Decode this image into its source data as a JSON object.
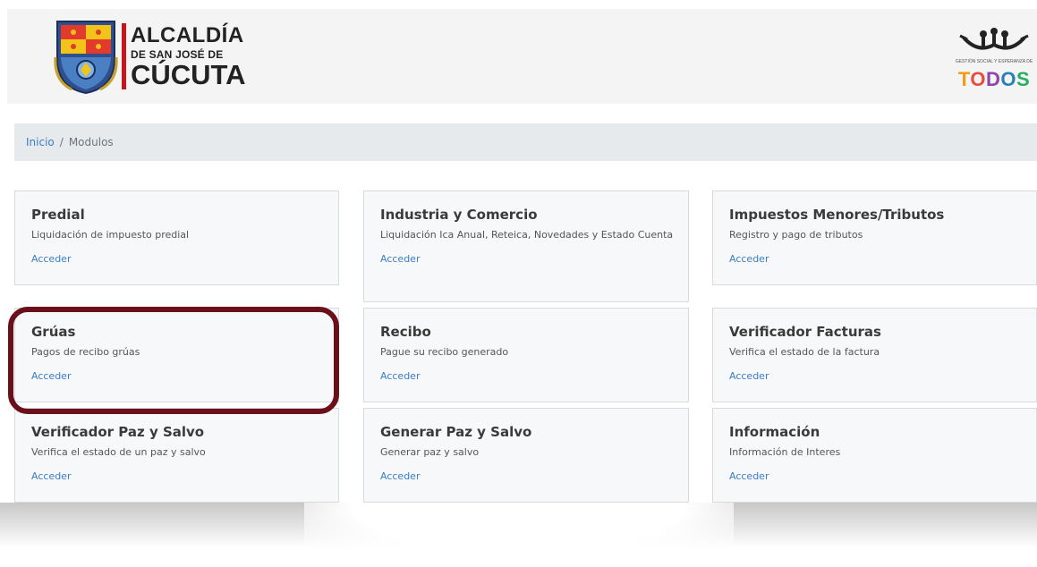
{
  "header": {
    "logo_left": {
      "line1": "ALCALDÍA",
      "line2": "DE SAN JOSÉ DE",
      "line3": "CÚCUTA"
    },
    "logo_right": {
      "tagline": "GESTIÓN SOCIAL Y ESPERANZA DE",
      "brand": "TODOS",
      "letters": [
        "T",
        "O",
        "D",
        "O",
        "S"
      ]
    }
  },
  "breadcrumb": {
    "home": "Inicio",
    "separator": "/",
    "current": "Modulos"
  },
  "cards": [
    {
      "title": "Predial",
      "desc": "Liquidación de impuesto predial",
      "link": "Acceder"
    },
    {
      "title": "Industria y Comercio",
      "desc": "Liquidación Ica Anual, Reteica, Novedades y Estado Cuenta",
      "link": "Acceder"
    },
    {
      "title": "Impuestos Menores/Tributos",
      "desc": "Registro y pago de tributos",
      "link": "Acceder"
    },
    {
      "title": "Grúas",
      "desc": "Pagos de recibo grúas",
      "link": "Acceder"
    },
    {
      "title": "Recibo",
      "desc": "Pague su recibo generado",
      "link": "Acceder"
    },
    {
      "title": "Verificador Facturas",
      "desc": "Verifica el estado de la factura",
      "link": "Acceder"
    },
    {
      "title": "Verificador Paz y Salvo",
      "desc": "Verifica el estado de un paz y salvo",
      "link": "Acceder"
    },
    {
      "title": "Generar Paz y Salvo",
      "desc": "Generar paz y salvo",
      "link": "Acceder"
    },
    {
      "title": "Información",
      "desc": "Información de Interes",
      "link": "Acceder"
    }
  ],
  "colors": {
    "link": "#3b7dc4",
    "highlight": "#6b0f1a",
    "logo_bar": "#c4161c",
    "breadcrumb_bg": "#e7eaed"
  }
}
